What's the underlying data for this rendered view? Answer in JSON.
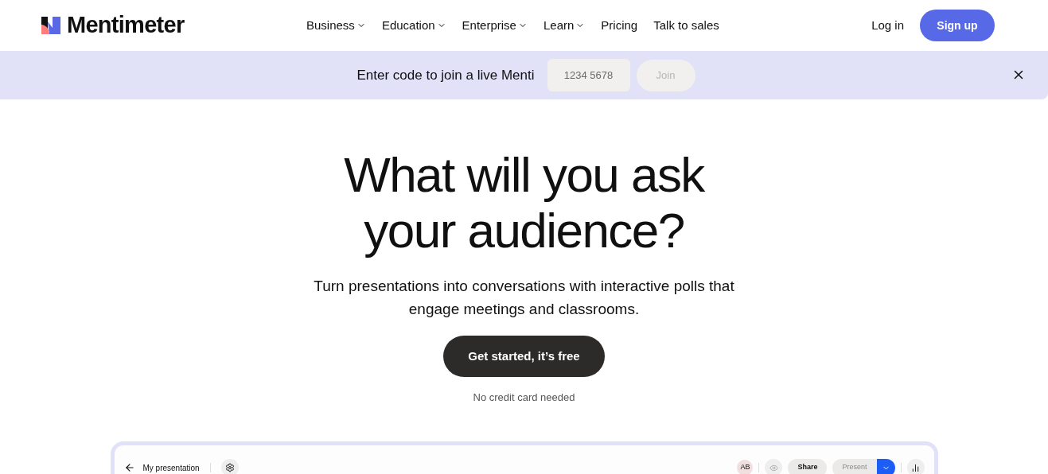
{
  "brand": {
    "name": "Mentimeter"
  },
  "nav": [
    {
      "label": "Business",
      "has_menu": true
    },
    {
      "label": "Education",
      "has_menu": true
    },
    {
      "label": "Enterprise",
      "has_menu": true
    },
    {
      "label": "Learn",
      "has_menu": true
    },
    {
      "label": "Pricing",
      "has_menu": false
    },
    {
      "label": "Talk to sales",
      "has_menu": false
    }
  ],
  "login": "Log in",
  "signup": "Sign up",
  "banner": {
    "text": "Enter code to join a live Menti",
    "placeholder": "1234 5678",
    "button": {
      "label": "Join",
      "disabled": true
    }
  },
  "hero": {
    "title": "What will you ask your audience?",
    "subtitle": "Turn presentations into conversations with interactive polls that engage meetings and classrooms.",
    "cta": "Get started, it’s free",
    "note": "No credit card needed"
  },
  "editor": {
    "title": "My presentation",
    "avatar": "AB",
    "share": "Share",
    "present": {
      "label": "Present",
      "disabled": true
    }
  }
}
